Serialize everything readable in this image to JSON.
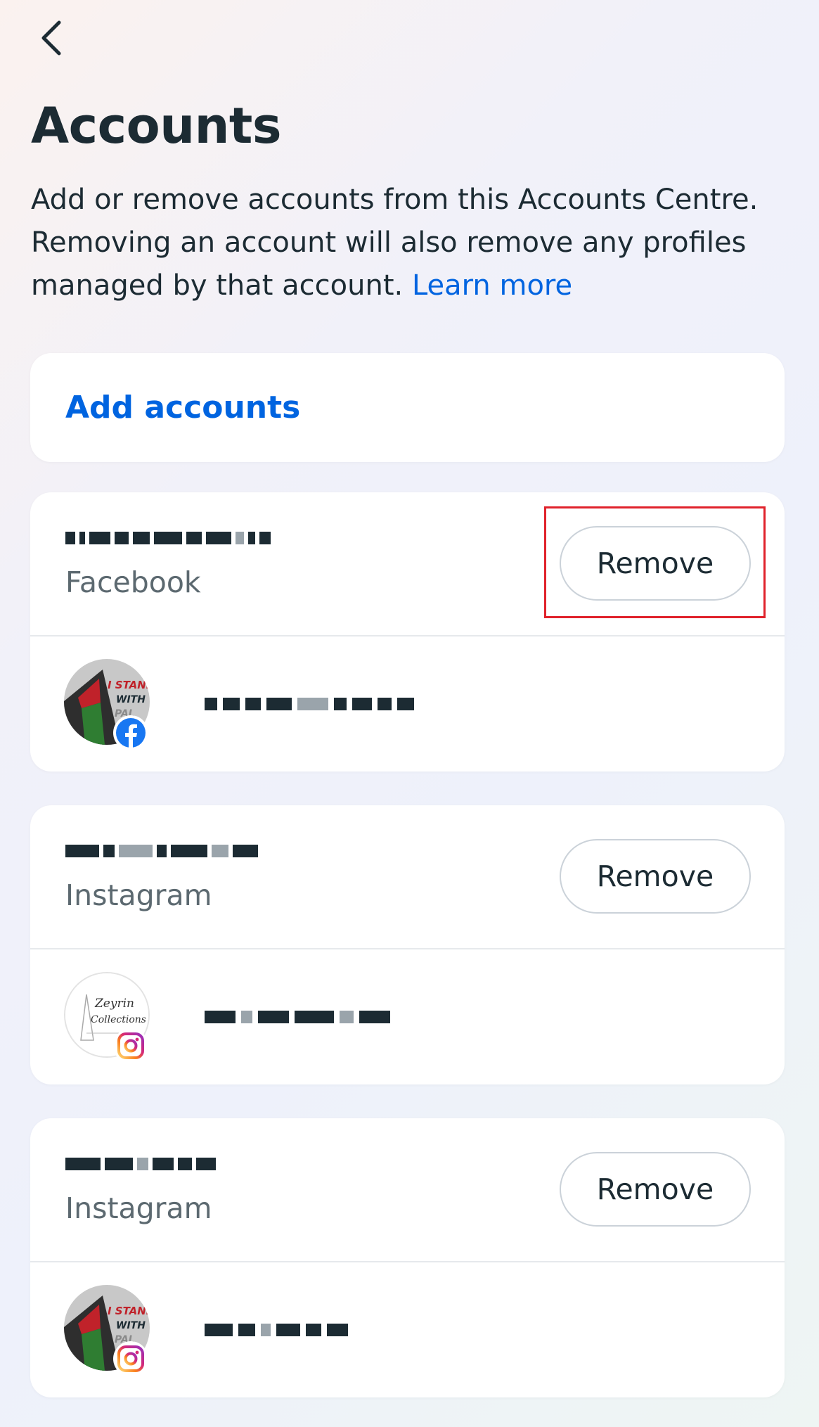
{
  "header": {
    "back_icon": "chevron-left-icon",
    "title": "Accounts",
    "description": "Add or remove accounts from this Accounts Centre. Removing an account will also remove any profiles managed by that account.",
    "learn_more": "Learn more"
  },
  "add_accounts": {
    "label": "Add accounts"
  },
  "accounts": [
    {
      "platform": "Facebook",
      "remove_label": "Remove",
      "highlighted": true,
      "profile_badge": "facebook-icon",
      "avatar_text": [
        "I STAND",
        "WITH",
        "PAL"
      ]
    },
    {
      "platform": "Instagram",
      "remove_label": "Remove",
      "highlighted": false,
      "profile_badge": "instagram-icon",
      "avatar_text": [
        "Zeyrin",
        "Collections"
      ]
    },
    {
      "platform": "Instagram",
      "remove_label": "Remove",
      "highlighted": false,
      "profile_badge": "instagram-icon",
      "avatar_text": [
        "I STAND",
        "WITH",
        "PAL"
      ]
    }
  ],
  "colors": {
    "accent_blue": "#0064e0",
    "text_primary": "#1c2b33",
    "text_secondary": "#5c6970",
    "highlight_red": "#e0222b",
    "facebook_blue": "#1877f2"
  }
}
